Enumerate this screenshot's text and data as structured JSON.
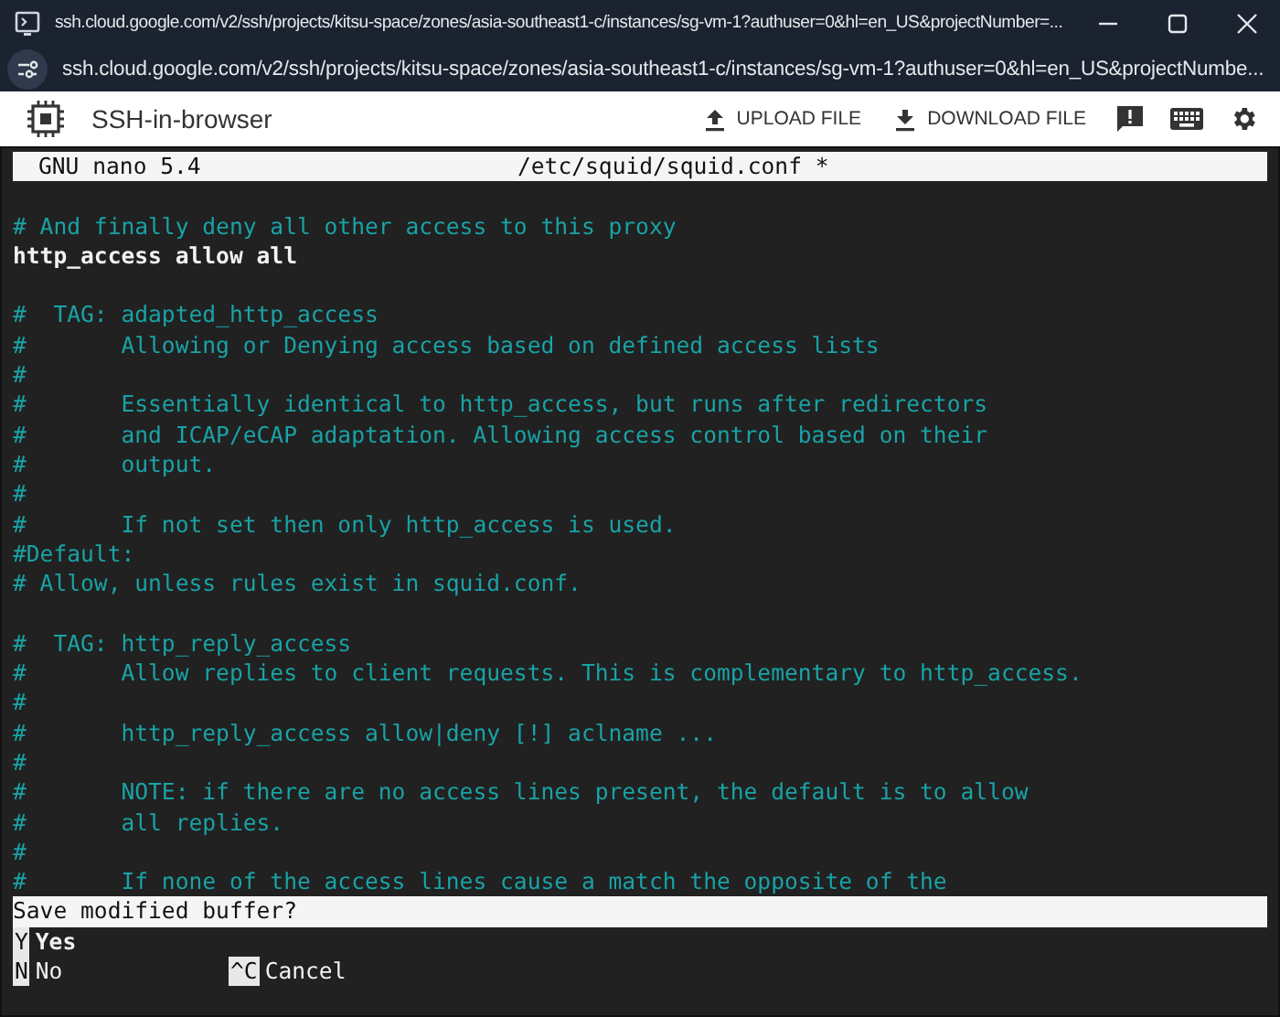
{
  "window": {
    "title": "ssh.cloud.google.com/v2/ssh/projects/kitsu-space/zones/asia-southeast1-c/instances/sg-vm-1?authuser=0&hl=en_US&projectNumber=..."
  },
  "address_bar": {
    "url": "ssh.cloud.google.com/v2/ssh/projects/kitsu-space/zones/asia-southeast1-c/instances/sg-vm-1?authuser=0&hl=en_US&projectNumbe..."
  },
  "toolbar": {
    "app_name": "SSH-in-browser",
    "buttons": [
      {
        "label": "UPLOAD FILE",
        "kind": "upload"
      },
      {
        "label": "DOWNLOAD FILE",
        "kind": "download"
      }
    ]
  },
  "editor": {
    "version": "GNU nano 5.4",
    "filename": "/etc/squid/squid.conf *",
    "lines": [
      {
        "kind": "blank"
      },
      {
        "kind": "comment",
        "text": "# And finally deny all other access to this proxy"
      },
      {
        "kind": "directive",
        "text": "http_access allow all"
      },
      {
        "kind": "blank"
      },
      {
        "kind": "comment",
        "text": "#  TAG: adapted_http_access"
      },
      {
        "kind": "comment",
        "text": "#       Allowing or Denying access based on defined access lists"
      },
      {
        "kind": "comment",
        "text": "#"
      },
      {
        "kind": "comment",
        "text": "#       Essentially identical to http_access, but runs after redirectors"
      },
      {
        "kind": "comment",
        "text": "#       and ICAP/eCAP adaptation. Allowing access control based on their"
      },
      {
        "kind": "comment",
        "text": "#       output."
      },
      {
        "kind": "comment",
        "text": "#"
      },
      {
        "kind": "comment",
        "text": "#       If not set then only http_access is used."
      },
      {
        "kind": "comment",
        "text": "#Default:"
      },
      {
        "kind": "comment",
        "text": "# Allow, unless rules exist in squid.conf."
      },
      {
        "kind": "blank"
      },
      {
        "kind": "comment",
        "text": "#  TAG: http_reply_access"
      },
      {
        "kind": "comment",
        "text": "#       Allow replies to client requests. This is complementary to http_access."
      },
      {
        "kind": "comment",
        "text": "#"
      },
      {
        "kind": "comment",
        "text": "#       http_reply_access allow|deny [!] aclname ..."
      },
      {
        "kind": "comment",
        "text": "#"
      },
      {
        "kind": "comment",
        "text": "#       NOTE: if there are no access lines present, the default is to allow"
      },
      {
        "kind": "comment",
        "text": "#       all replies."
      },
      {
        "kind": "comment",
        "text": "#"
      },
      {
        "kind": "comment",
        "text": "#       If none of the access lines cause a match the opposite of the"
      }
    ],
    "prompt": "Save modified buffer?",
    "shortcuts": [
      {
        "key": "Y",
        "label": "Yes"
      },
      {
        "key": "N",
        "label": "No"
      },
      {
        "key": "^C",
        "label": "Cancel"
      }
    ]
  }
}
